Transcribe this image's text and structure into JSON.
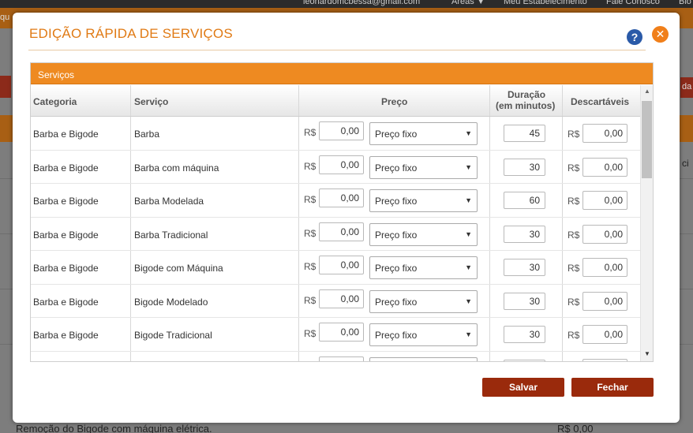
{
  "background": {
    "email": "leonardomcbessa@gmail.com",
    "nav": [
      "Áreas ▼",
      "Meu Estabelecimento",
      "Fale Conosco",
      "Blo"
    ],
    "left_fragment": "qu",
    "right_button_fragment": "da",
    "right_text_fragment": "ci",
    "bottom_service": "Remoção do Bigode com máquina elétrica.",
    "bottom_price": "R$ 0,00"
  },
  "modal": {
    "title": "EDIÇÃO RÁPIDA DE SERVIÇOS",
    "help_icon": "?",
    "close_icon": "✕",
    "panel_title": "Serviços",
    "headers": {
      "categoria": "Categoria",
      "servico": "Serviço",
      "preco": "Preço",
      "duracao_1": "Duração",
      "duracao_2": "(em minutos)",
      "descartaveis": "Descartáveis"
    },
    "currency": "R$",
    "rows": [
      {
        "categoria": "Barba e Bigode",
        "servico": "Barba",
        "preco": "0,00",
        "tipo": "Preço fixo",
        "duracao": "45",
        "descartaveis": "0,00"
      },
      {
        "categoria": "Barba e Bigode",
        "servico": "Barba com máquina",
        "preco": "0,00",
        "tipo": "Preço fixo",
        "duracao": "30",
        "descartaveis": "0,00"
      },
      {
        "categoria": "Barba e Bigode",
        "servico": "Barba Modelada",
        "preco": "0,00",
        "tipo": "Preço fixo",
        "duracao": "60",
        "descartaveis": "0,00"
      },
      {
        "categoria": "Barba e Bigode",
        "servico": "Barba Tradicional",
        "preco": "0,00",
        "tipo": "Preço fixo",
        "duracao": "30",
        "descartaveis": "0,00"
      },
      {
        "categoria": "Barba e Bigode",
        "servico": "Bigode com Máquina",
        "preco": "0,00",
        "tipo": "Preço fixo",
        "duracao": "30",
        "descartaveis": "0,00"
      },
      {
        "categoria": "Barba e Bigode",
        "servico": "Bigode Modelado",
        "preco": "0,00",
        "tipo": "Preço fixo",
        "duracao": "30",
        "descartaveis": "0,00"
      },
      {
        "categoria": "Barba e Bigode",
        "servico": "Bigode Tradicional",
        "preco": "0,00",
        "tipo": "Preço fixo",
        "duracao": "30",
        "descartaveis": "0,00"
      }
    ],
    "buttons": {
      "save": "Salvar",
      "close": "Fechar"
    }
  },
  "colors": {
    "accent": "#ee8a21",
    "title": "#e07a14",
    "button": "#9a2a0c",
    "help": "#2a5aa8"
  }
}
